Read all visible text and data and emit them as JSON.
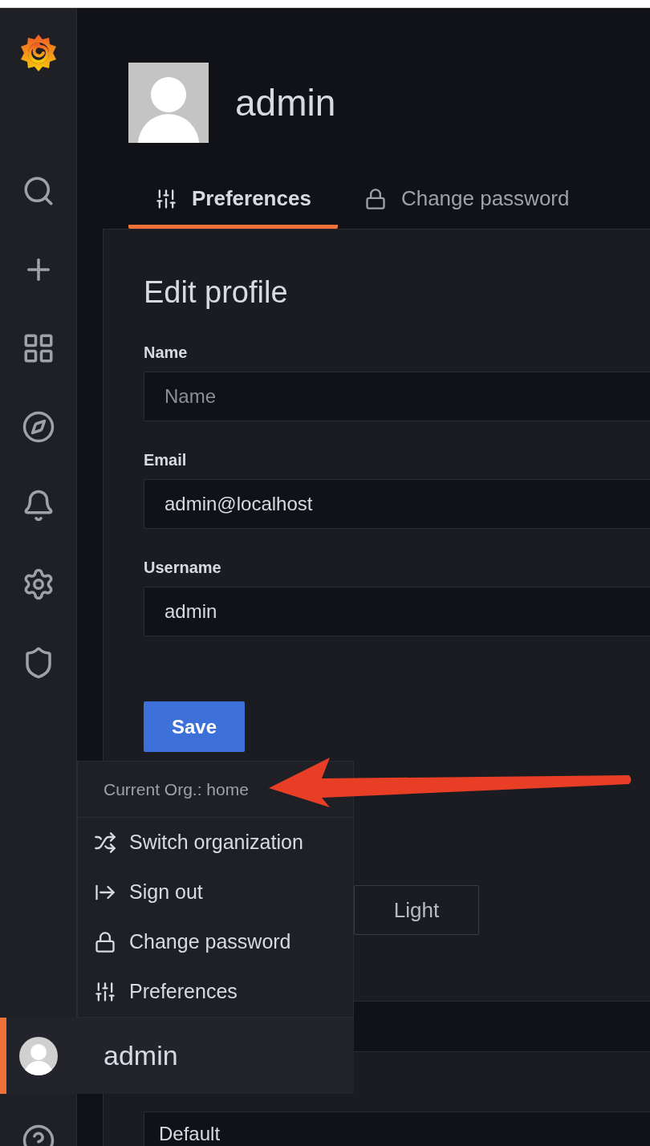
{
  "profile": {
    "name": "admin"
  },
  "tabs": [
    {
      "label": "Preferences",
      "selected": true
    },
    {
      "label": "Change password",
      "selected": false
    }
  ],
  "edit_profile": {
    "title": "Edit profile",
    "fields": [
      {
        "label": "Name",
        "placeholder": "Name"
      },
      {
        "label": "Email",
        "value": "admin@localhost"
      },
      {
        "label": "Username",
        "value": "admin"
      }
    ],
    "save_button": "Save"
  },
  "theme_options": [
    {
      "label": "Light",
      "selected": false
    }
  ],
  "timezone": {
    "value": "Default"
  },
  "user_menu": {
    "header": "Current Org.: home",
    "items": [
      {
        "label": "Switch organization"
      },
      {
        "label": "Sign out"
      },
      {
        "label": "Change password"
      },
      {
        "label": "Preferences"
      }
    ],
    "user": {
      "name": "admin",
      "active": true
    }
  }
}
